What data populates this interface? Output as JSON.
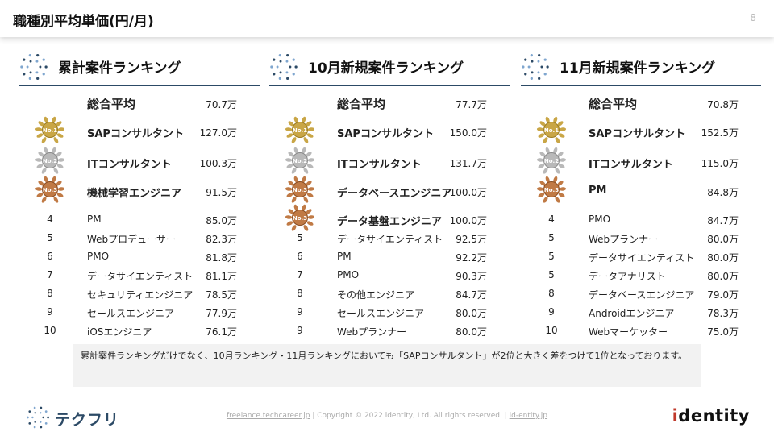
{
  "header": {
    "title": "職種別平均単価(円/月)",
    "page_number": "8"
  },
  "colors": {
    "rule": "#2c4a66",
    "gold": "#c9a646",
    "silver": "#b9b9b9",
    "bronze": "#c07a45",
    "note_bg": "#f2f2f2"
  },
  "columns": [
    {
      "title": "累計案件ランキング",
      "average": {
        "label": "総合平均",
        "value": "70.7万"
      },
      "rows": [
        {
          "rank": "",
          "medal": "gold",
          "name": "SAPコンサルタント",
          "value": "127.0万"
        },
        {
          "rank": "",
          "medal": "silver",
          "name": "ITコンサルタント",
          "value": "100.3万"
        },
        {
          "rank": "",
          "medal": "bronze",
          "name": "機械学習エンジニア",
          "value": "91.5万"
        },
        {
          "rank": "4",
          "medal": "",
          "name": "PM",
          "value": "85.0万"
        },
        {
          "rank": "5",
          "medal": "",
          "name": "Webプロデューサー",
          "value": "82.3万"
        },
        {
          "rank": "6",
          "medal": "",
          "name": "PMO",
          "value": "81.8万"
        },
        {
          "rank": "7",
          "medal": "",
          "name": "データサイエンティスト",
          "value": "81.1万"
        },
        {
          "rank": "8",
          "medal": "",
          "name": "セキュリティエンジニア",
          "value": "78.5万"
        },
        {
          "rank": "9",
          "medal": "",
          "name": "セールスエンジニア",
          "value": "77.9万"
        },
        {
          "rank": "10",
          "medal": "",
          "name": "iOSエンジニア",
          "value": "76.1万"
        }
      ]
    },
    {
      "title": "10月新規案件ランキング",
      "average": {
        "label": "総合平均",
        "value": "77.7万"
      },
      "rows": [
        {
          "rank": "",
          "medal": "gold",
          "name": "SAPコンサルタント",
          "value": "150.0万"
        },
        {
          "rank": "",
          "medal": "silver",
          "name": "ITコンサルタント",
          "value": "131.7万"
        },
        {
          "rank": "",
          "medal": "bronze",
          "name": "データベースエンジニア",
          "value": "100.0万"
        },
        {
          "rank": "",
          "medal": "bronze",
          "name": "データ基盤エンジニア",
          "value": "100.0万"
        },
        {
          "rank": "5",
          "medal": "",
          "name": "データサイエンティスト",
          "value": "92.5万"
        },
        {
          "rank": "6",
          "medal": "",
          "name": "PM",
          "value": "92.2万"
        },
        {
          "rank": "7",
          "medal": "",
          "name": "PMO",
          "value": "90.3万"
        },
        {
          "rank": "8",
          "medal": "",
          "name": "その他エンジニア",
          "value": "84.7万"
        },
        {
          "rank": "9",
          "medal": "",
          "name": "セールスエンジニア",
          "value": "80.0万"
        },
        {
          "rank": "9",
          "medal": "",
          "name": "Webプランナー",
          "value": "80.0万"
        }
      ]
    },
    {
      "title": "11月新規案件ランキング",
      "average": {
        "label": "総合平均",
        "value": "70.8万"
      },
      "rows": [
        {
          "rank": "",
          "medal": "gold",
          "name": "SAPコンサルタント",
          "value": "152.5万"
        },
        {
          "rank": "",
          "medal": "silver",
          "name": "ITコンサルタント",
          "value": "115.0万"
        },
        {
          "rank": "",
          "medal": "bronze",
          "name": "PM",
          "value": "84.8万"
        },
        {
          "rank": "4",
          "medal": "",
          "name": "PMO",
          "value": "84.7万"
        },
        {
          "rank": "5",
          "medal": "",
          "name": "Webプランナー",
          "value": "80.0万"
        },
        {
          "rank": "5",
          "medal": "",
          "name": "データサイエンティスト",
          "value": "80.0万"
        },
        {
          "rank": "5",
          "medal": "",
          "name": "データアナリスト",
          "value": "80.0万"
        },
        {
          "rank": "8",
          "medal": "",
          "name": "データベースエンジニア",
          "value": "79.0万"
        },
        {
          "rank": "9",
          "medal": "",
          "name": "Androidエンジニア",
          "value": "78.3万"
        },
        {
          "rank": "10",
          "medal": "",
          "name": "Webマーケッター",
          "value": "75.0万"
        }
      ]
    }
  ],
  "note": "累計案件ランキングだけでなく、10月ランキング・11月ランキングにおいても「SAPコンサルタント」が2位と大きく差をつけて1位となっております。",
  "footer": {
    "brand": "テクフリ",
    "link1": "freelance.techcareer.jp",
    "copyright": "| Copyright © 2022 identity, Ltd. All rights reserved. |",
    "link2": "id-entity.jp",
    "logo_i": "i",
    "logo_rest": "dentity"
  },
  "medal_text": {
    "gold": "No.1",
    "silver": "No.2",
    "bronze": "No.3"
  },
  "icons": {
    "header": "dots-ring-icon",
    "medal": "laurel-medal-icon"
  }
}
